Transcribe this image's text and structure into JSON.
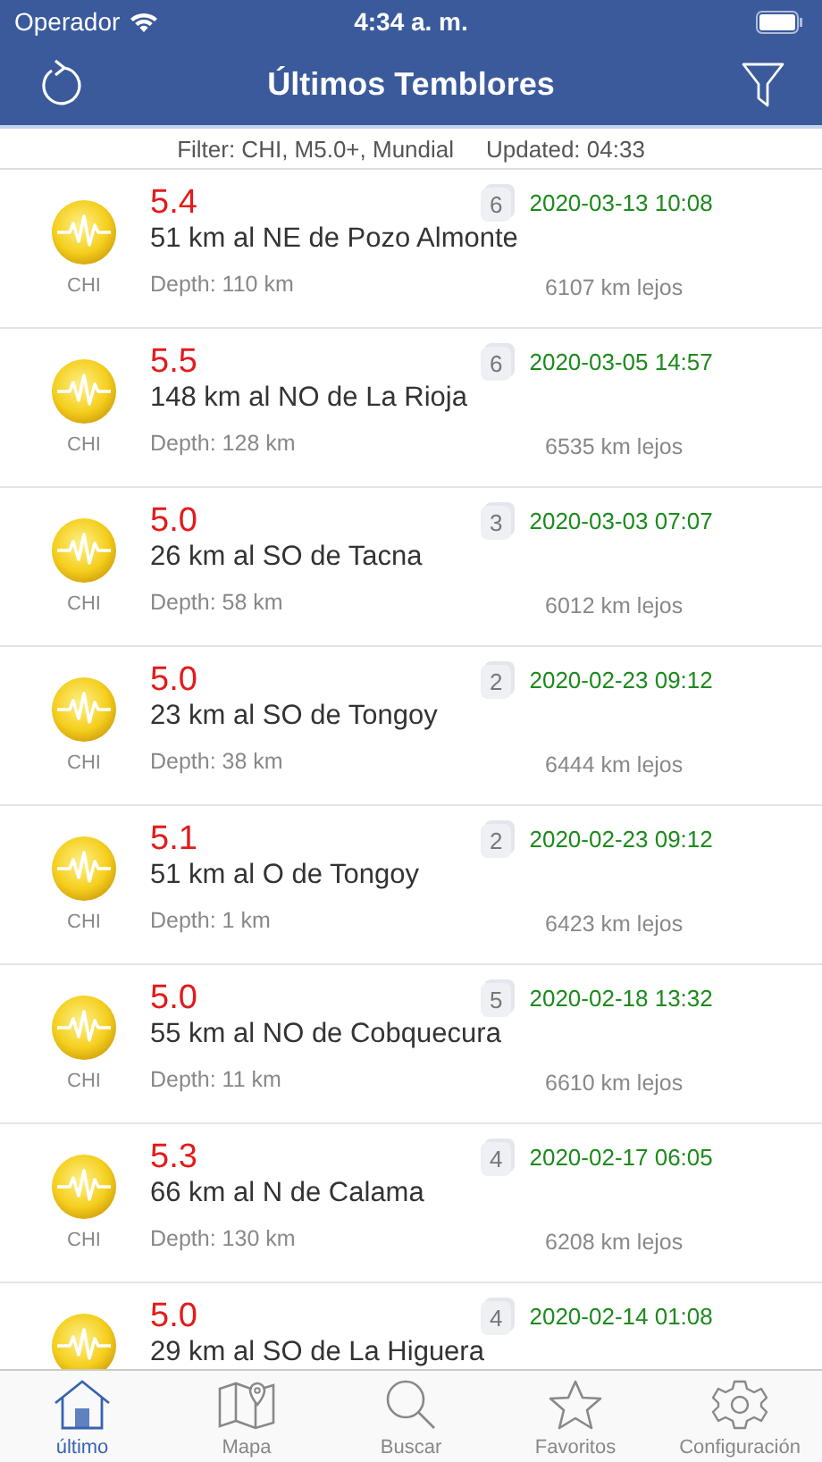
{
  "status_bar": {
    "carrier": "Operador",
    "time": "4:34 a. m."
  },
  "nav": {
    "title": "Últimos Temblores"
  },
  "filter_bar": {
    "filter": "Filter: CHI, M5.0+, Mundial",
    "updated": "Updated: 04:33"
  },
  "quakes": [
    {
      "magnitude": "5.4",
      "place": "51 km al NE de Pozo Almonte",
      "country": "CHI",
      "count": "6",
      "datetime": "2020-03-13 10:08",
      "depth": "Depth: 110 km",
      "distance": "6107 km lejos"
    },
    {
      "magnitude": "5.5",
      "place": "148 km al NO de La Rioja",
      "country": "CHI",
      "count": "6",
      "datetime": "2020-03-05 14:57",
      "depth": "Depth: 128 km",
      "distance": "6535 km lejos"
    },
    {
      "magnitude": "5.0",
      "place": "26 km al SO de Tacna",
      "country": "CHI",
      "count": "3",
      "datetime": "2020-03-03 07:07",
      "depth": "Depth: 58 km",
      "distance": "6012 km lejos"
    },
    {
      "magnitude": "5.0",
      "place": "23 km al SO de Tongoy",
      "country": "CHI",
      "count": "2",
      "datetime": "2020-02-23 09:12",
      "depth": "Depth: 38 km",
      "distance": "6444 km lejos"
    },
    {
      "magnitude": "5.1",
      "place": "51 km al O de Tongoy",
      "country": "CHI",
      "count": "2",
      "datetime": "2020-02-23 09:12",
      "depth": "Depth: 1 km",
      "distance": "6423 km lejos"
    },
    {
      "magnitude": "5.0",
      "place": "55 km al NO de Cobquecura",
      "country": "CHI",
      "count": "5",
      "datetime": "2020-02-18 13:32",
      "depth": "Depth: 11 km",
      "distance": "6610 km lejos"
    },
    {
      "magnitude": "5.3",
      "place": "66 km al N de Calama",
      "country": "CHI",
      "count": "4",
      "datetime": "2020-02-17 06:05",
      "depth": "Depth: 130 km",
      "distance": "6208 km lejos"
    },
    {
      "magnitude": "5.0",
      "place": "29 km al SO de La Higuera",
      "count": "4",
      "datetime": "2020-02-14 01:08"
    }
  ],
  "tab_bar": [
    {
      "kind": "home",
      "label": "último",
      "selected": true
    },
    {
      "kind": "map",
      "label": "Mapa",
      "selected": false
    },
    {
      "kind": "search",
      "label": "Buscar",
      "selected": false
    },
    {
      "kind": "star",
      "label": "Favoritos",
      "selected": false
    },
    {
      "kind": "gear",
      "label": "Configuración",
      "selected": false
    }
  ]
}
